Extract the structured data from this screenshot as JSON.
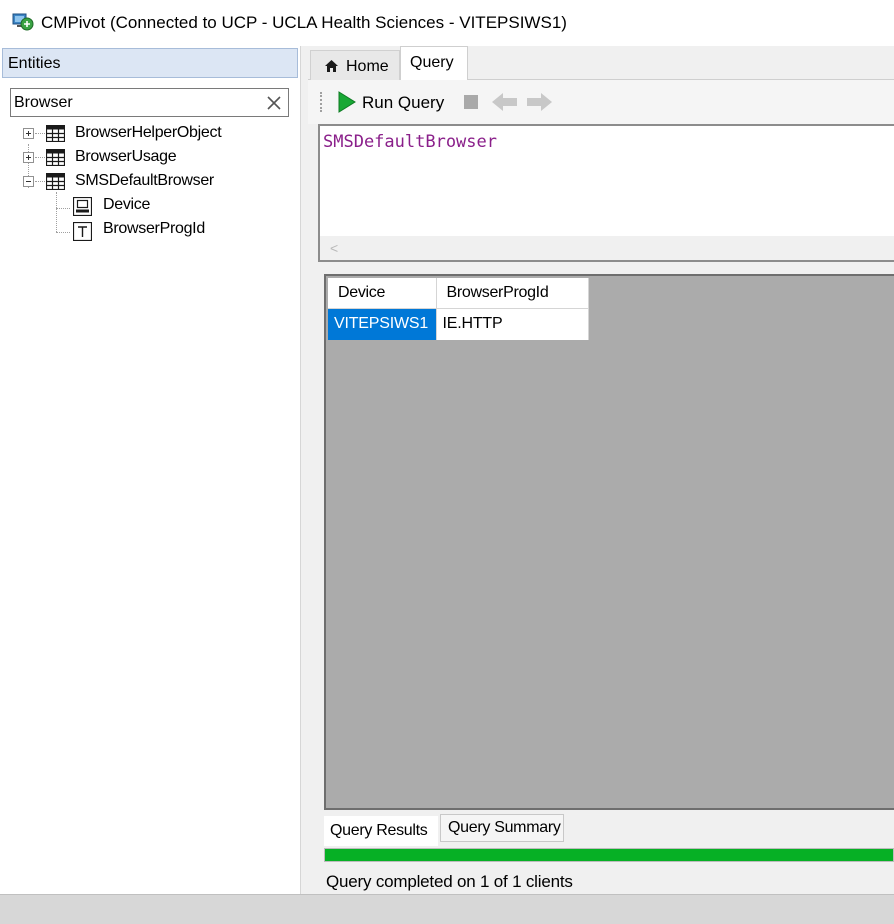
{
  "window": {
    "title": "CMPivot (Connected to UCP - UCLA Health Sciences - VITEPSIWS1)"
  },
  "colors": {
    "accent_blue": "#0078d7",
    "progress_green": "#06b025",
    "query_text": "#8a1f8a",
    "run_green": "#18a835"
  },
  "entities": {
    "header": "Entities",
    "search": {
      "value": "Browser"
    },
    "tree": [
      {
        "label": "BrowserHelperObject",
        "icon": "table-icon",
        "expanded": false
      },
      {
        "label": "BrowserUsage",
        "icon": "table-icon",
        "expanded": false
      },
      {
        "label": "SMSDefaultBrowser",
        "icon": "table-icon",
        "expanded": true,
        "children": [
          {
            "label": "Device",
            "icon": "device-icon"
          },
          {
            "label": "BrowserProgId",
            "icon": "text-field-icon"
          }
        ]
      }
    ]
  },
  "tabs": {
    "home": "Home",
    "query": "Query"
  },
  "toolbar": {
    "run_label": "Run Query"
  },
  "editor": {
    "query": "SMSDefaultBrowser"
  },
  "results": {
    "columns": [
      "Device",
      "BrowserProgId"
    ],
    "rows": [
      [
        "VITEPSIWS1",
        "IE.HTTP"
      ]
    ]
  },
  "result_tabs": {
    "results": "Query Results",
    "summary": "Query Summary"
  },
  "progress": {
    "percent": 100
  },
  "status": {
    "text": "Query completed on 1 of 1 clients"
  }
}
